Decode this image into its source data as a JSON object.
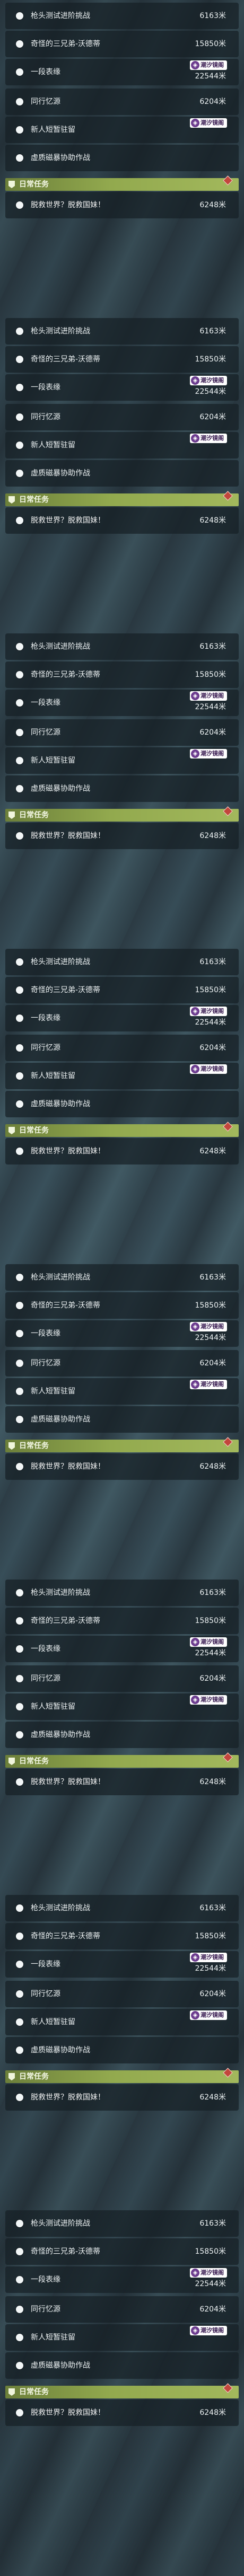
{
  "blocks": [
    {
      "quests": [
        {
          "title": "枪头测试进阶挑战",
          "distance": "6163米"
        },
        {
          "title": "奇怪的三兄弟-沃德蒂",
          "distance": "15850米"
        },
        {
          "title": "一段表缘",
          "distance": "22544米",
          "badge": "潮汐镜阁"
        },
        {
          "title": "同行忆源",
          "distance": "6204米"
        },
        {
          "title": "新人短暂驻留",
          "badge": "潮汐镜阁"
        },
        {
          "title": "虚质磁暴协助作战"
        }
      ],
      "section": "日常任务",
      "daily": {
        "title": "脱救世界？脱救国妹！",
        "distance": "6248米"
      }
    },
    {
      "quests": [
        {
          "title": "枪头测试进阶挑战",
          "distance": "6163米"
        },
        {
          "title": "奇怪的三兄弟-沃德蒂",
          "distance": "15850米"
        },
        {
          "title": "一段表缘",
          "distance": "22544米",
          "badge": "潮汐镜阁"
        },
        {
          "title": "同行忆源",
          "distance": "6204米"
        },
        {
          "title": "新人短暂驻留",
          "badge": "潮汐镜阁"
        },
        {
          "title": "虚质磁暴协助作战"
        }
      ],
      "section": "日常任务",
      "daily": {
        "title": "脱救世界？脱救国妹！",
        "distance": "6248米"
      }
    },
    {
      "quests": [
        {
          "title": "枪头测试进阶挑战",
          "distance": "6163米"
        },
        {
          "title": "奇怪的三兄弟-沃德蒂",
          "distance": "15850米"
        },
        {
          "title": "一段表缘",
          "distance": "22544米",
          "badge": "潮汐镜阁"
        },
        {
          "title": "同行忆源",
          "distance": "6204米"
        },
        {
          "title": "新人短暂驻留",
          "badge": "潮汐镜阁"
        },
        {
          "title": "虚质磁暴协助作战"
        }
      ],
      "section": "日常任务",
      "daily": {
        "title": "脱救世界？脱救国妹！",
        "distance": "6248米"
      }
    },
    {
      "quests": [
        {
          "title": "枪头测试进阶挑战",
          "distance": "6163米"
        },
        {
          "title": "奇怪的三兄弟-沃德蒂",
          "distance": "15850米"
        },
        {
          "title": "一段表缘",
          "distance": "22544米",
          "badge": "潮汐镜阁"
        },
        {
          "title": "同行忆源",
          "distance": "6204米"
        },
        {
          "title": "新人短暂驻留",
          "badge": "潮汐镜阁"
        },
        {
          "title": "虚质磁暴协助作战"
        }
      ],
      "section": "日常任务",
      "daily": {
        "title": "脱救世界？脱救国妹！",
        "distance": "6248米"
      }
    },
    {
      "quests": [
        {
          "title": "枪头测试进阶挑战",
          "distance": "6163米"
        },
        {
          "title": "奇怪的三兄弟-沃德蒂",
          "distance": "15850米"
        },
        {
          "title": "一段表缘",
          "distance": "22544米",
          "badge": "潮汐镜阁"
        },
        {
          "title": "同行忆源",
          "distance": "6204米"
        },
        {
          "title": "新人短暂驻留",
          "badge": "潮汐镜阁"
        },
        {
          "title": "虚质磁暴协助作战"
        }
      ],
      "section": "日常任务",
      "daily": {
        "title": "脱救世界？脱救国妹！",
        "distance": "6248米"
      }
    },
    {
      "quests": [
        {
          "title": "枪头测试进阶挑战",
          "distance": "6163米"
        },
        {
          "title": "奇怪的三兄弟-沃德蒂",
          "distance": "15850米"
        },
        {
          "title": "一段表缘",
          "distance": "22544米",
          "badge": "潮汐镜阁"
        },
        {
          "title": "同行忆源",
          "distance": "6204米"
        },
        {
          "title": "新人短暂驻留",
          "badge": "潮汐镜阁"
        },
        {
          "title": "虚质磁暴协助作战"
        }
      ],
      "section": "日常任务",
      "daily": {
        "title": "脱救世界？脱救国妹！",
        "distance": "6248米"
      }
    },
    {
      "quests": [
        {
          "title": "枪头测试进阶挑战",
          "distance": "6163米"
        },
        {
          "title": "奇怪的三兄弟-沃德蒂",
          "distance": "15850米"
        },
        {
          "title": "一段表缘",
          "distance": "22544米",
          "badge": "潮汐镜阁"
        },
        {
          "title": "同行忆源",
          "distance": "6204米"
        },
        {
          "title": "新人短暂驻留",
          "badge": "潮汐镜阁"
        },
        {
          "title": "虚质磁暴协助作战"
        }
      ],
      "section": "日常任务",
      "daily": {
        "title": "脱救世界？脱救国妹！",
        "distance": "6248米"
      }
    },
    {
      "quests": [
        {
          "title": "枪头测试进阶挑战",
          "distance": "6163米"
        },
        {
          "title": "奇怪的三兄弟-沃德蒂",
          "distance": "15850米"
        },
        {
          "title": "一段表缘",
          "distance": "22544米",
          "badge": "潮汐镜阁"
        },
        {
          "title": "同行忆源",
          "distance": "6204米"
        },
        {
          "title": "新人短暂驻留",
          "badge": "潮汐镜阁"
        },
        {
          "title": "虚质磁暴协助作战"
        }
      ],
      "section": "日常任务",
      "daily": {
        "title": "脱救世界？脱救国妹！",
        "distance": "6248米"
      }
    }
  ],
  "colors": {
    "row_bg": "#162026",
    "section_bar": "#92a94e",
    "badge_text": "#3a1d52",
    "badge_icon": "#6c3c8e",
    "marker": "#c2463c"
  },
  "icons": {
    "quest_bullet": "circle-bullet-icon",
    "section_flag": "flag-icon",
    "badge_icon": "tidal-mirror-icon",
    "daily_marker": "diamond-marker-icon"
  }
}
